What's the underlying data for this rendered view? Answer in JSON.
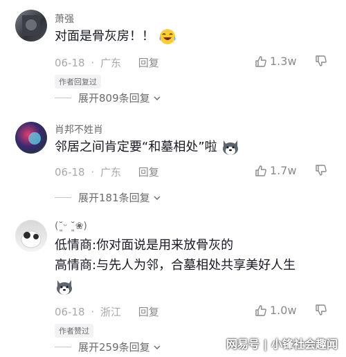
{
  "comments": [
    {
      "username": "萧强",
      "text": "对面是骨灰房！！",
      "emoji": "laughing-tears-emoji",
      "date": "06-18",
      "location": "广东",
      "reply_label": "回复",
      "likes": "1.3w",
      "tag": "作者回复过",
      "expand_label": "展开809条回复"
    },
    {
      "username": "肖邦不姓肖",
      "text": "邻居之间肯定要“和墓相处”啦",
      "emoji": "husky-dog-emoji",
      "date": "06-18",
      "location": "广东",
      "reply_label": "回复",
      "likes": "1.7w",
      "expand_label": "展开181条回复"
    },
    {
      "username": "(˘͈ᵕ ˘͈❀)",
      "text_line1": "低情商:你对面说是用来放骨灰的",
      "text_line2": "高情商:与先人为邻，合墓相处共享美好人生",
      "emoji": "husky-dog-emoji",
      "date": "06-18",
      "location": "浙江",
      "reply_label": "回复",
      "likes": "1.0w",
      "tag": "作者赞过",
      "expand_label": "展开259条回复"
    }
  ],
  "watermark": "网易号 | 小锋社会趣闻",
  "colors": {
    "text": "#161823",
    "meta": "#a8a8a8",
    "name": "#6b6b6b",
    "tag_bg": "#f2f2f4"
  }
}
